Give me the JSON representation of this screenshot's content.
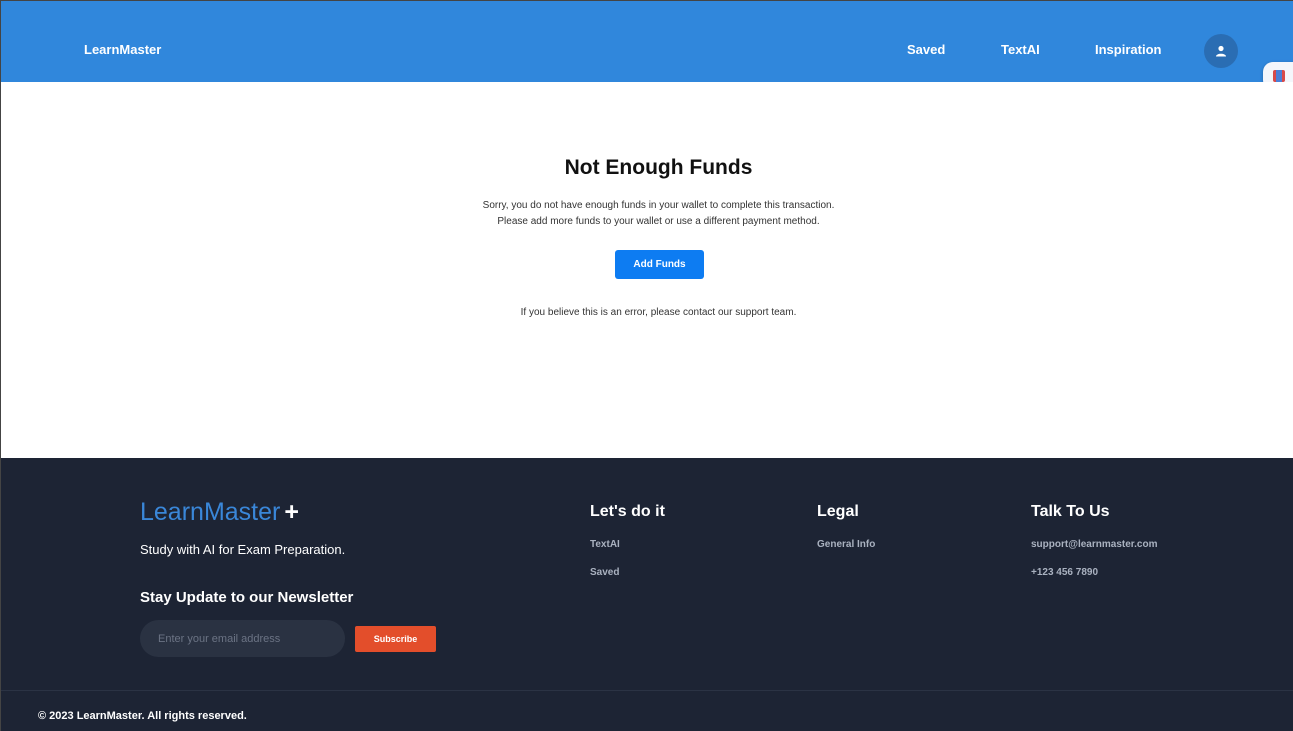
{
  "header": {
    "brand": "LearnMaster",
    "nav": {
      "saved": "Saved",
      "textai": "TextAI",
      "inspiration": "Inspiration"
    }
  },
  "main": {
    "title": "Not Enough Funds",
    "message_line1": "Sorry, you do not have enough funds in your wallet to complete this transaction.",
    "message_line2": "Please add more funds to your wallet or use a different payment method.",
    "add_funds_label": "Add Funds",
    "support_note": "If you believe this is an error, please contact our support team."
  },
  "footer": {
    "logo": "LearnMaster",
    "logo_plus": "+",
    "tagline": "Study with AI for Exam Preparation.",
    "newsletter_heading": "Stay Update to our Newsletter",
    "email_placeholder": "Enter your email address",
    "subscribe_label": "Subscribe",
    "columns": [
      {
        "heading": "Let's do it",
        "links": [
          "TextAI",
          "Saved"
        ]
      },
      {
        "heading": "Legal",
        "links": [
          "General Info"
        ]
      },
      {
        "heading": "Talk To Us",
        "links": [
          "support@learnmaster.com",
          "+123 456 7890"
        ]
      }
    ],
    "copyright": "© 2023 LearnMaster. All rights reserved."
  },
  "colors": {
    "header_bg": "#3087dc",
    "primary_button": "#0d7cf2",
    "footer_bg": "#1d2434",
    "subscribe_button": "#e34e2b",
    "logo_blue": "#3a87d9"
  },
  "icons": {
    "avatar": "user-icon",
    "side_widget": "bookmark-icon"
  }
}
